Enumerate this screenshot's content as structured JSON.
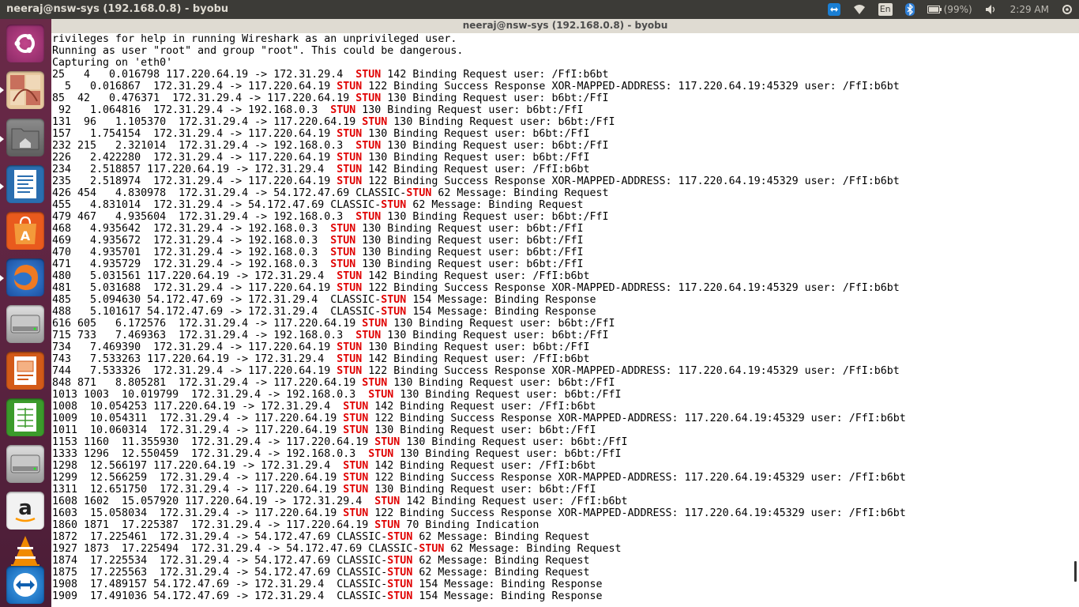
{
  "top_panel": {
    "title": "neeraj@nsw-sys (192.168.0.8) - byobu",
    "keyboard_layout": "En",
    "battery_text": "(99%)",
    "clock": "2:29 AM"
  },
  "window": {
    "title": "neeraj@nsw-sys (192.168.0.8) - byobu"
  },
  "launcher": {
    "items": [
      "Ubuntu Dash",
      "Workspace",
      "Files",
      "LibreOffice Writer",
      "Ubuntu Software Center",
      "Firefox",
      "Disk",
      "LibreOffice Impress",
      "LibreOffice Calc",
      "Disk",
      "Amazon",
      "VLC",
      "Teamviewer"
    ]
  },
  "terminal": {
    "highlight_color": "#e00000",
    "lines": [
      "rivileges for help in running Wireshark as an unprivileged user.",
      "Running as user \"root\" and group \"root\". This could be dangerous.",
      "Capturing on 'eth0'",
      "25   4   0.016798 117.220.64.19 -> 172.31.29.4  STUN 142 Binding Request user: /FfI:b6bt",
      "  5   0.016867  172.31.29.4 -> 117.220.64.19 STUN 122 Binding Success Response XOR-MAPPED-ADDRESS: 117.220.64.19:45329 user: /FfI:b6bt",
      "85  42   0.476371  172.31.29.4 -> 117.220.64.19 STUN 130 Binding Request user: b6bt:/FfI",
      " 92   1.064816  172.31.29.4 -> 192.168.0.3  STUN 130 Binding Request user: b6bt:/FfI",
      "131  96   1.105370  172.31.29.4 -> 117.220.64.19 STUN 130 Binding Request user: b6bt:/FfI",
      "157   1.754154  172.31.29.4 -> 117.220.64.19 STUN 130 Binding Request user: b6bt:/FfI",
      "232 215   2.321014  172.31.29.4 -> 192.168.0.3  STUN 130 Binding Request user: b6bt:/FfI",
      "226   2.422280  172.31.29.4 -> 117.220.64.19 STUN 130 Binding Request user: b6bt:/FfI",
      "234   2.518857 117.220.64.19 -> 172.31.29.4  STUN 142 Binding Request user: /FfI:b6bt",
      "235   2.518974  172.31.29.4 -> 117.220.64.19 STUN 122 Binding Success Response XOR-MAPPED-ADDRESS: 117.220.64.19:45329 user: /FfI:b6bt",
      "426 454   4.830978  172.31.29.4 -> 54.172.47.69 CLASSIC-STUN 62 Message: Binding Request",
      "455   4.831014  172.31.29.4 -> 54.172.47.69 CLASSIC-STUN 62 Message: Binding Request",
      "479 467   4.935604  172.31.29.4 -> 192.168.0.3  STUN 130 Binding Request user: b6bt:/FfI",
      "468   4.935642  172.31.29.4 -> 192.168.0.3  STUN 130 Binding Request user: b6bt:/FfI",
      "469   4.935672  172.31.29.4 -> 192.168.0.3  STUN 130 Binding Request user: b6bt:/FfI",
      "470   4.935701  172.31.29.4 -> 192.168.0.3  STUN 130 Binding Request user: b6bt:/FfI",
      "471   4.935729  172.31.29.4 -> 192.168.0.3  STUN 130 Binding Request user: b6bt:/FfI",
      "480   5.031561 117.220.64.19 -> 172.31.29.4  STUN 142 Binding Request user: /FfI:b6bt",
      "481   5.031688  172.31.29.4 -> 117.220.64.19 STUN 122 Binding Success Response XOR-MAPPED-ADDRESS: 117.220.64.19:45329 user: /FfI:b6bt",
      "485   5.094630 54.172.47.69 -> 172.31.29.4  CLASSIC-STUN 154 Message: Binding Response",
      "488   5.101617 54.172.47.69 -> 172.31.29.4  CLASSIC-STUN 154 Message: Binding Response",
      "616 605   6.172576  172.31.29.4 -> 117.220.64.19 STUN 130 Binding Request user: b6bt:/FfI",
      "715 733   7.469363  172.31.29.4 -> 192.168.0.3  STUN 130 Binding Request user: b6bt:/FfI",
      "734   7.469390  172.31.29.4 -> 117.220.64.19 STUN 130 Binding Request user: b6bt:/FfI",
      "743   7.533263 117.220.64.19 -> 172.31.29.4  STUN 142 Binding Request user: /FfI:b6bt",
      "744   7.533326  172.31.29.4 -> 117.220.64.19 STUN 122 Binding Success Response XOR-MAPPED-ADDRESS: 117.220.64.19:45329 user: /FfI:b6bt",
      "848 871   8.805281  172.31.29.4 -> 117.220.64.19 STUN 130 Binding Request user: b6bt:/FfI",
      "1013 1003  10.019799  172.31.29.4 -> 192.168.0.3  STUN 130 Binding Request user: b6bt:/FfI",
      "1008  10.054253 117.220.64.19 -> 172.31.29.4  STUN 142 Binding Request user: /FfI:b6bt",
      "1009  10.054311  172.31.29.4 -> 117.220.64.19 STUN 122 Binding Success Response XOR-MAPPED-ADDRESS: 117.220.64.19:45329 user: /FfI:b6bt",
      "1011  10.060314  172.31.29.4 -> 117.220.64.19 STUN 130 Binding Request user: b6bt:/FfI",
      "1153 1160  11.355930  172.31.29.4 -> 117.220.64.19 STUN 130 Binding Request user: b6bt:/FfI",
      "1333 1296  12.550459  172.31.29.4 -> 192.168.0.3  STUN 130 Binding Request user: b6bt:/FfI",
      "1298  12.566197 117.220.64.19 -> 172.31.29.4  STUN 142 Binding Request user: /FfI:b6bt",
      "1299  12.566259  172.31.29.4 -> 117.220.64.19 STUN 122 Binding Success Response XOR-MAPPED-ADDRESS: 117.220.64.19:45329 user: /FfI:b6bt",
      "1311  12.651750  172.31.29.4 -> 117.220.64.19 STUN 130 Binding Request user: b6bt:/FfI",
      "1608 1602  15.057920 117.220.64.19 -> 172.31.29.4  STUN 142 Binding Request user: /FfI:b6bt",
      "1603  15.058034  172.31.29.4 -> 117.220.64.19 STUN 122 Binding Success Response XOR-MAPPED-ADDRESS: 117.220.64.19:45329 user: /FfI:b6bt",
      "1860 1871  17.225387  172.31.29.4 -> 117.220.64.19 STUN 70 Binding Indication",
      "1872  17.225461  172.31.29.4 -> 54.172.47.69 CLASSIC-STUN 62 Message: Binding Request",
      "1927 1873  17.225494  172.31.29.4 -> 54.172.47.69 CLASSIC-STUN 62 Message: Binding Request",
      "1874  17.225534  172.31.29.4 -> 54.172.47.69 CLASSIC-STUN 62 Message: Binding Request",
      "1875  17.225563  172.31.29.4 -> 54.172.47.69 CLASSIC-STUN 62 Message: Binding Request",
      "1908  17.489157 54.172.47.69 -> 172.31.29.4  CLASSIC-STUN 154 Message: Binding Response",
      "1909  17.491036 54.172.47.69 -> 172.31.29.4  CLASSIC-STUN 154 Message: Binding Response"
    ]
  }
}
